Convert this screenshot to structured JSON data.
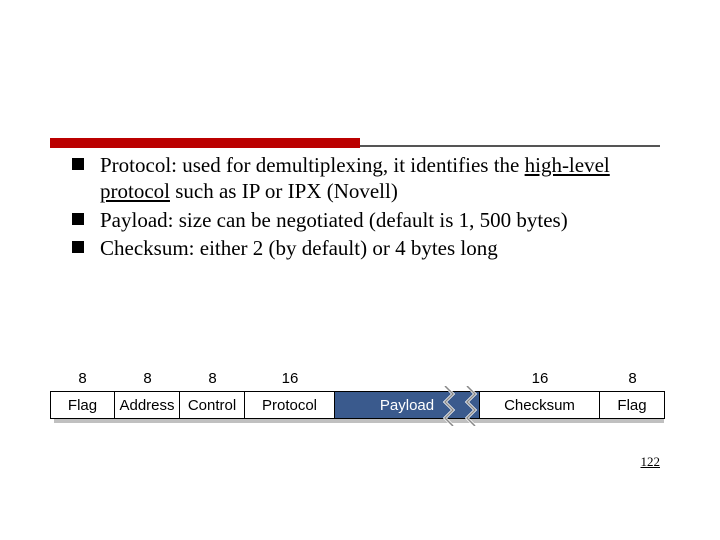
{
  "bullets": [
    {
      "prefix": "Protocol: ",
      "mid": "used for demultiplexing, it identifies the ",
      "underlined": "high-level protocol",
      "suffix": " such as IP or IPX (Novell)"
    },
    {
      "prefix": "Payload: ",
      "mid": "size can be negotiated (default is 1, 500 bytes)",
      "underlined": "",
      "suffix": ""
    },
    {
      "prefix": "Checksum: ",
      "mid": "either 2 (by default) or 4 bytes long",
      "underlined": "",
      "suffix": ""
    }
  ],
  "frame": {
    "widths": [
      "8",
      "8",
      "8",
      "16",
      "",
      "16",
      "8"
    ],
    "labels": [
      "Flag",
      "Address",
      "Control",
      "Protocol",
      "Payload",
      "Checksum",
      "Flag"
    ]
  },
  "page_number": "122"
}
